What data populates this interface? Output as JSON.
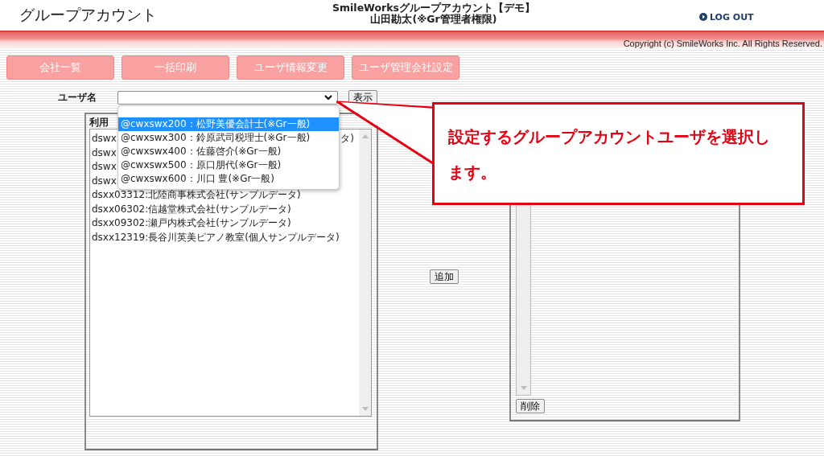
{
  "header": {
    "title": "グループアカウント",
    "app_title": "SmileWorksグループアカウント【デモ】",
    "user_line": "山田勘太(※Gr管理者権限)",
    "logout": "LOG OUT",
    "copyright": "Copyright (c) SmileWorks Inc. All Rights Reserved."
  },
  "nav": [
    {
      "label": "会社一覧"
    },
    {
      "label": "一括印刷"
    },
    {
      "label": "ユーザ情報変更"
    },
    {
      "label": "ユーザ管理会社設定"
    }
  ],
  "user_select": {
    "label": "ユーザ名",
    "button": "表示"
  },
  "dropdown": [
    {
      "text": "@cwxswx200：松野美優会計士(※Gr一般)",
      "selected": true
    },
    {
      "text": "@cwxswx300：鈴原武司税理士(※Gr一般)",
      "selected": false
    },
    {
      "text": "@cwxswx400：佐藤啓介(※Gr一般)",
      "selected": false
    },
    {
      "text": "@cwxswx500：原口朋代(※Gr一般)",
      "selected": false
    },
    {
      "text": "@cwxswx600：川口 豊(※Gr一般)",
      "selected": false
    }
  ],
  "left_panel": {
    "legend": "利用",
    "items": [
      {
        "text": "dswx",
        "tail": "タ)"
      },
      {
        "text": "dswx"
      },
      {
        "text": "dswx"
      },
      {
        "text": "dswx"
      },
      {
        "text": "dsxx03312:北陸商事株式会社(サンプルデータ)"
      },
      {
        "text": "dsxx06302:信越堂株式会社(サンプルデータ)"
      },
      {
        "text": "dsxx09302:瀬戸内株式会社(サンプルデータ)"
      },
      {
        "text": "dsxx12319:長谷川英美ピアノ教室(個人サンプルデータ)"
      }
    ]
  },
  "add_button": "追加",
  "remove_button": "削除",
  "callout": "設定するグループアカウントユーザを選択します。"
}
